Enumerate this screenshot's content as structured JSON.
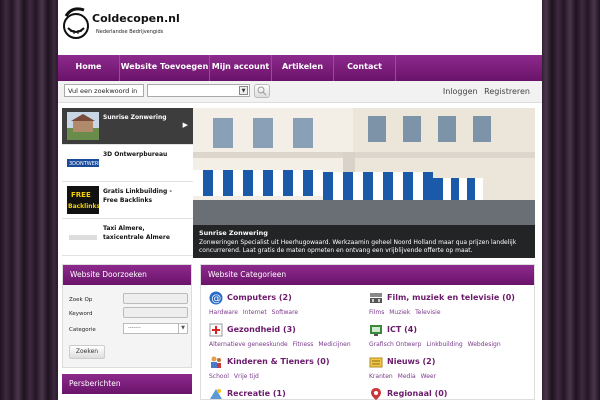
{
  "header": {
    "site_name": "Coldecopen.nl",
    "tagline": "Nederlandse Bedrijvengids"
  },
  "nav": {
    "items": [
      {
        "label": "Home"
      },
      {
        "label": "Website Toevoegen"
      },
      {
        "label": "Mijn account"
      },
      {
        "label": "Artikelen"
      },
      {
        "label": "Contact"
      }
    ]
  },
  "search": {
    "input_value": "Vul een zoekwoord in",
    "select_value": ""
  },
  "auth": {
    "login": "Inloggen",
    "register": "Registreren"
  },
  "slider": {
    "items": [
      {
        "label": "Sunrise Zonwering",
        "active": true
      },
      {
        "label": "3D Ontwerpbureau",
        "active": false
      },
      {
        "label": "Gratis Linkbuilding - Free Backlinks",
        "active": false
      },
      {
        "label": "Taxi Almere, taxicentrale Almere",
        "active": false
      }
    ],
    "caption_title": "Sunrise Zonwering",
    "caption_text": "Zonweringen Specialist uit Heerhugowaard. Werkzaamin geheel Noord Holland maar qua prijzen landelijk concurrerend. Laat gratis de maten opmeten en ontvang een vrijblijvende offerte op maat."
  },
  "search_box": {
    "title": "Website Doorzoeken",
    "label_zoek_op": "Zoek Op",
    "label_keyword": "Keyword",
    "label_categorie": "Categorie",
    "categorie_value": "-------",
    "button": "Zoeken"
  },
  "press": {
    "title": "Persberichten"
  },
  "categories": {
    "title": "Website Categorieen",
    "items": [
      {
        "title": "Computers (2)",
        "subs": [
          "Hardware",
          "Internet",
          "Software"
        ],
        "icon": "at-icon"
      },
      {
        "title": "Film, muziek en televisie (0)",
        "subs": [
          "Films",
          "Muziek",
          "Televisie"
        ],
        "icon": "film-icon"
      },
      {
        "title": "Gezondheid (3)",
        "subs": [
          "Alternatieve geneeskunde",
          "Fitness",
          "Medicijnen"
        ],
        "icon": "health-icon"
      },
      {
        "title": "ICT (4)",
        "subs": [
          "Grafisch Ontwerp",
          "Linkbuilding",
          "Webdesign"
        ],
        "icon": "ict-icon"
      },
      {
        "title": "Kinderen & Tieners (0)",
        "subs": [
          "School",
          "Vrije tijd"
        ],
        "icon": "kids-icon"
      },
      {
        "title": "Nieuws (2)",
        "subs": [
          "Kranten",
          "Media",
          "Weer"
        ],
        "icon": "news-icon"
      },
      {
        "title": "Recreatie (1)",
        "subs": [],
        "icon": "recreation-icon"
      },
      {
        "title": "Regionaal (0)",
        "subs": [],
        "icon": "location-icon"
      }
    ]
  },
  "colors": {
    "brand_purple": "#7a1f7a",
    "link_purple": "#6b1a6b"
  }
}
